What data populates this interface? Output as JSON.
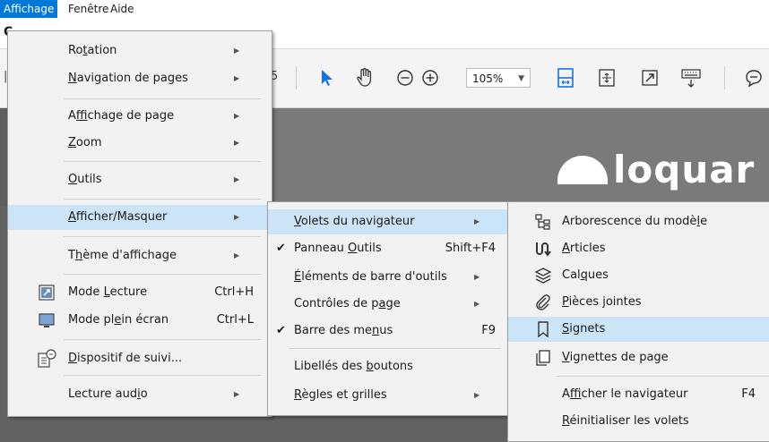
{
  "menubar": {
    "items": [
      "Affichage",
      "Fenêtre",
      "Aide"
    ]
  },
  "toolbar": {
    "page_fragment": "5",
    "zoom_value": "105%"
  },
  "brand": {
    "text": "loquar"
  },
  "tabstrip": {
    "letter": "C"
  },
  "main_menu": {
    "items": [
      {
        "pre": "Ro",
        "u": "t",
        "post": "ation",
        "shortcut": "",
        "arrow": true
      },
      {
        "pre": "",
        "u": "N",
        "post": "avigation de pages",
        "shortcut": "",
        "arrow": true
      },
      {
        "pre": "A",
        "u": "f",
        "post": "fichage de page",
        "shortcut": "",
        "arrow": true
      },
      {
        "pre": "",
        "u": "Z",
        "post": "oom",
        "shortcut": "",
        "arrow": true
      },
      {
        "pre": "",
        "u": "O",
        "post": "utils",
        "shortcut": "",
        "arrow": true
      },
      {
        "pre": "",
        "u": "A",
        "post": "fficher/Masquer",
        "shortcut": "",
        "arrow": true
      },
      {
        "pre": "T",
        "u": "h",
        "post": "ème d'affichage",
        "shortcut": "",
        "arrow": true
      },
      {
        "pre": "Mode ",
        "u": "L",
        "post": "ecture",
        "shortcut": "Ctrl+H",
        "arrow": false
      },
      {
        "pre": "Mode pl",
        "u": "e",
        "post": "in écran",
        "shortcut": "Ctrl+L",
        "arrow": false
      },
      {
        "pre": "",
        "u": "D",
        "post": "ispositif de suivi...",
        "shortcut": "",
        "arrow": false
      },
      {
        "pre": "Lecture aud",
        "u": "i",
        "post": "o",
        "shortcut": "",
        "arrow": true
      }
    ]
  },
  "sub_menu": {
    "items": [
      {
        "pre": "",
        "u": "V",
        "post": "olets du navigateur",
        "shortcut": "",
        "arrow": true,
        "checked": false
      },
      {
        "pre": "Panneau ",
        "u": "O",
        "post": "utils",
        "shortcut": "Shift+F4",
        "arrow": false,
        "checked": true
      },
      {
        "pre": "",
        "u": "É",
        "post": "léments de barre d'outils",
        "shortcut": "",
        "arrow": true,
        "checked": false
      },
      {
        "pre": "Contrôles de p",
        "u": "a",
        "post": "ge",
        "shortcut": "",
        "arrow": true,
        "checked": false
      },
      {
        "pre": "Barre des me",
        "u": "n",
        "post": "us",
        "shortcut": "F9",
        "arrow": false,
        "checked": true
      },
      {
        "pre": "Libellés des ",
        "u": "b",
        "post": "outons",
        "shortcut": "",
        "arrow": false,
        "checked": false
      },
      {
        "pre": "",
        "u": "R",
        "post": "ègles et grilles",
        "shortcut": "",
        "arrow": true,
        "checked": false
      }
    ]
  },
  "sub_sub_menu": {
    "items": [
      {
        "pre": "Arborescence du modè",
        "u": "l",
        "post": "e",
        "shortcut": "",
        "icon": "tree-icon"
      },
      {
        "pre": "",
        "u": "A",
        "post": "rticles",
        "shortcut": "",
        "icon": "articles-icon"
      },
      {
        "pre": "Cal",
        "u": "q",
        "post": "ues",
        "shortcut": "",
        "icon": "layers-icon"
      },
      {
        "pre": "",
        "u": "P",
        "post": "ièces jointes",
        "shortcut": "",
        "icon": "paperclip-icon"
      },
      {
        "pre": "",
        "u": "S",
        "post": "ignets",
        "shortcut": "",
        "icon": "bookmark-icon"
      },
      {
        "pre": "",
        "u": "V",
        "post": "ignettes de page",
        "shortcut": "",
        "icon": "thumbnails-icon"
      },
      {
        "pre": "A",
        "u": "f",
        "post": "ficher le navigateur",
        "shortcut": "F4",
        "icon": ""
      },
      {
        "pre": "",
        "u": "R",
        "post": "éinitialiser les volets",
        "shortcut": "",
        "icon": ""
      }
    ]
  },
  "colors": {
    "accent": "#0078d7",
    "highlight": "#cce4f7",
    "menu_bg": "#f2f2f2",
    "icon_blue": "#1473e6"
  }
}
